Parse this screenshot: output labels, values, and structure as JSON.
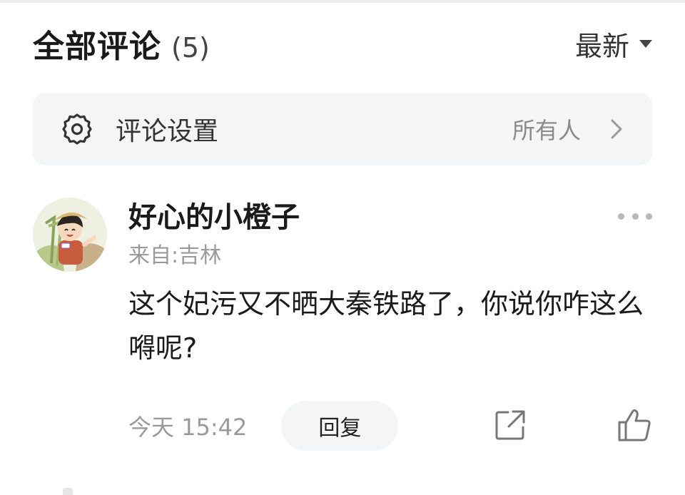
{
  "header": {
    "title": "全部评论",
    "count": "(5)",
    "sort_label": "最新"
  },
  "settings": {
    "label": "评论设置",
    "value": "所有人",
    "icon": "gear-icon"
  },
  "comment": {
    "username": "好心的小橙子",
    "location": "来自:吉林",
    "text": "这个妃污又不晒大秦铁路了，你说你咋这么嘚呢?",
    "time": "今天 15:42",
    "reply_label": "回复",
    "icons": [
      "more-icon",
      "share-icon",
      "like-icon"
    ]
  }
}
